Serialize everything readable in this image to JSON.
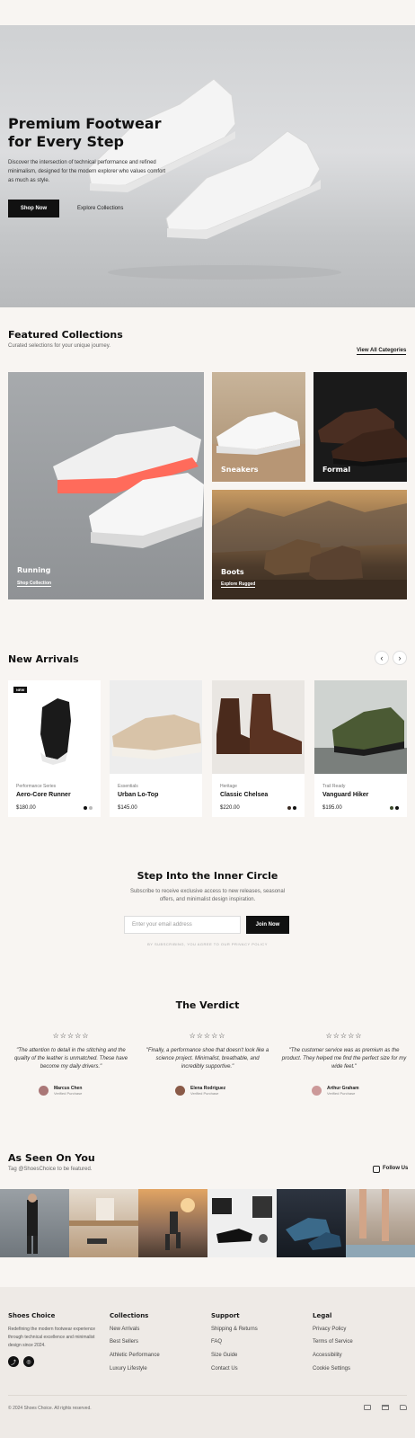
{
  "hero": {
    "title": "Premium Footwear for Every Step",
    "subtitle": "Discover the intersection of technical performance and refined minimalism, designed for the modern explorer who values comfort as much as style.",
    "shop_now": "Shop Now",
    "explore": "Explore Collections"
  },
  "collections": {
    "title": "Featured Collections",
    "subtitle": "Curated selections for your unique journey.",
    "view_all": "View All Categories",
    "tiles": [
      {
        "label": "Running",
        "link": "Shop Collection"
      },
      {
        "label": "Sneakers"
      },
      {
        "label": "Formal"
      },
      {
        "label": "Boots",
        "link": "Explore Rugged"
      }
    ]
  },
  "arrivals": {
    "title": "New Arrivals",
    "prev_icon": "chevron-left-icon",
    "next_icon": "chevron-right-icon",
    "badge": "NEW",
    "products": [
      {
        "category": "Performance Series",
        "name": "Aero-Core Runner",
        "price": "$180.00",
        "swatches": [
          "#111111",
          "#bbbbbb"
        ]
      },
      {
        "category": "Essentials",
        "name": "Urban Lo-Top",
        "price": "$145.00",
        "swatches": []
      },
      {
        "category": "Heritage",
        "name": "Classic Chelsea",
        "price": "$220.00",
        "swatches": [
          "#3a2b22",
          "#111111"
        ]
      },
      {
        "category": "Trail Ready",
        "name": "Vanguard Hiker",
        "price": "$195.00",
        "swatches": [
          "#3c4a2c",
          "#111111"
        ]
      }
    ]
  },
  "newsletter": {
    "title": "Step Into the Inner Circle",
    "subtitle": "Subscribe to receive exclusive access to new releases, seasonal offers, and minimalist design inspiration.",
    "placeholder": "Enter your email address",
    "button": "Join Now",
    "legal": "BY SUBSCRIBING, YOU AGREE TO OUR PRIVACY POLICY"
  },
  "reviews": {
    "title": "The Verdict",
    "stars": "☆☆☆☆☆",
    "items": [
      {
        "quote": "\"The attention to detail in the stitching and the quality of the leather is unmatched. These have become my daily drivers.\"",
        "name": "Marcus Chen",
        "verified": "Verified Purchase"
      },
      {
        "quote": "\"Finally, a performance shoe that doesn't look like a science project. Minimalist, breathable, and incredibly supportive.\"",
        "name": "Elena Rodriguez",
        "verified": "Verified Purchase"
      },
      {
        "quote": "\"The customer service was as premium as the product. They helped me find the perfect size for my wide feet.\"",
        "name": "Arthur Graham",
        "verified": "Verified Purchase"
      }
    ]
  },
  "seen": {
    "title": "As Seen On You",
    "subtitle": "Tag @ShoesChoice to be featured.",
    "follow": "Follow Us",
    "follow_icon": "instagram-icon"
  },
  "footer": {
    "brand": "Shoes Choice",
    "about": "Redefining the modern footwear experience through technical excellence and minimalist design since 2024.",
    "columns": [
      {
        "title": "Collections",
        "links": [
          "New Arrivals",
          "Best Sellers",
          "Athletic Performance",
          "Luxury Lifestyle"
        ]
      },
      {
        "title": "Support",
        "links": [
          "Shipping & Returns",
          "FAQ",
          "Size Guide",
          "Contact Us"
        ]
      },
      {
        "title": "Legal",
        "links": [
          "Privacy Policy",
          "Terms of Service",
          "Accessibility",
          "Cookie Settings"
        ]
      }
    ],
    "copyright": "© 2024 Shoes Choice. All rights reserved.",
    "social_icons": [
      "share-icon",
      "globe-icon"
    ],
    "payment_icons": [
      "card-icon",
      "bank-icon",
      "wallet-icon"
    ]
  }
}
